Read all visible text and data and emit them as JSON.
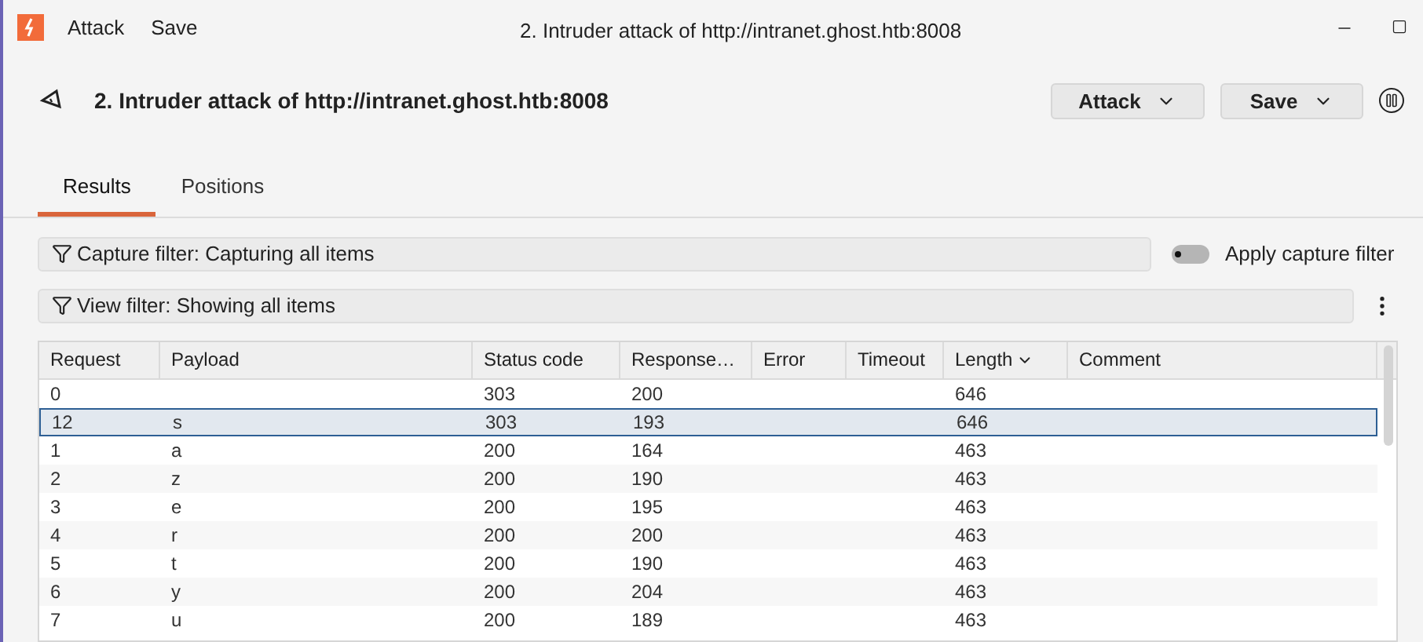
{
  "menu_bar": {
    "items": [
      "Attack",
      "Save"
    ],
    "title": "2. Intruder attack of http://intranet.ghost.htb:8008"
  },
  "header": {
    "title": "2. Intruder attack of http://intranet.ghost.htb:8008",
    "buttons": [
      "Attack",
      "Save"
    ]
  },
  "tabs": [
    {
      "label": "Results",
      "selected": true
    },
    {
      "label": "Positions",
      "selected": false
    }
  ],
  "capture_filter": {
    "label": "Capture filter: Capturing all items",
    "toggle_label": "Apply capture filter",
    "on": false
  },
  "view_filter": {
    "label": "View filter: Showing all items"
  },
  "table": {
    "columns": [
      {
        "label": "Request",
        "sorted": false
      },
      {
        "label": "Payload",
        "sorted": false
      },
      {
        "label": "Status code",
        "sorted": false
      },
      {
        "label": "Response…",
        "sorted": false
      },
      {
        "label": "Error",
        "sorted": false
      },
      {
        "label": "Timeout",
        "sorted": false
      },
      {
        "label": "Length",
        "sorted": true
      },
      {
        "label": "Comment",
        "sorted": false
      }
    ],
    "rows": [
      {
        "cells": [
          "0",
          "",
          "303",
          "200",
          "",
          "",
          "646",
          ""
        ],
        "selected": false
      },
      {
        "cells": [
          "12",
          "s",
          "303",
          "193",
          "",
          "",
          "646",
          ""
        ],
        "selected": true
      },
      {
        "cells": [
          "1",
          "a",
          "200",
          "164",
          "",
          "",
          "463",
          ""
        ],
        "selected": false
      },
      {
        "cells": [
          "2",
          "z",
          "200",
          "190",
          "",
          "",
          "463",
          ""
        ],
        "selected": false
      },
      {
        "cells": [
          "3",
          "e",
          "200",
          "195",
          "",
          "",
          "463",
          ""
        ],
        "selected": false
      },
      {
        "cells": [
          "4",
          "r",
          "200",
          "200",
          "",
          "",
          "463",
          ""
        ],
        "selected": false
      },
      {
        "cells": [
          "5",
          "t",
          "200",
          "190",
          "",
          "",
          "463",
          ""
        ],
        "selected": false
      },
      {
        "cells": [
          "6",
          "y",
          "200",
          "204",
          "",
          "",
          "463",
          ""
        ],
        "selected": false
      },
      {
        "cells": [
          "7",
          "u",
          "200",
          "189",
          "",
          "",
          "463",
          ""
        ],
        "selected": false
      }
    ]
  }
}
